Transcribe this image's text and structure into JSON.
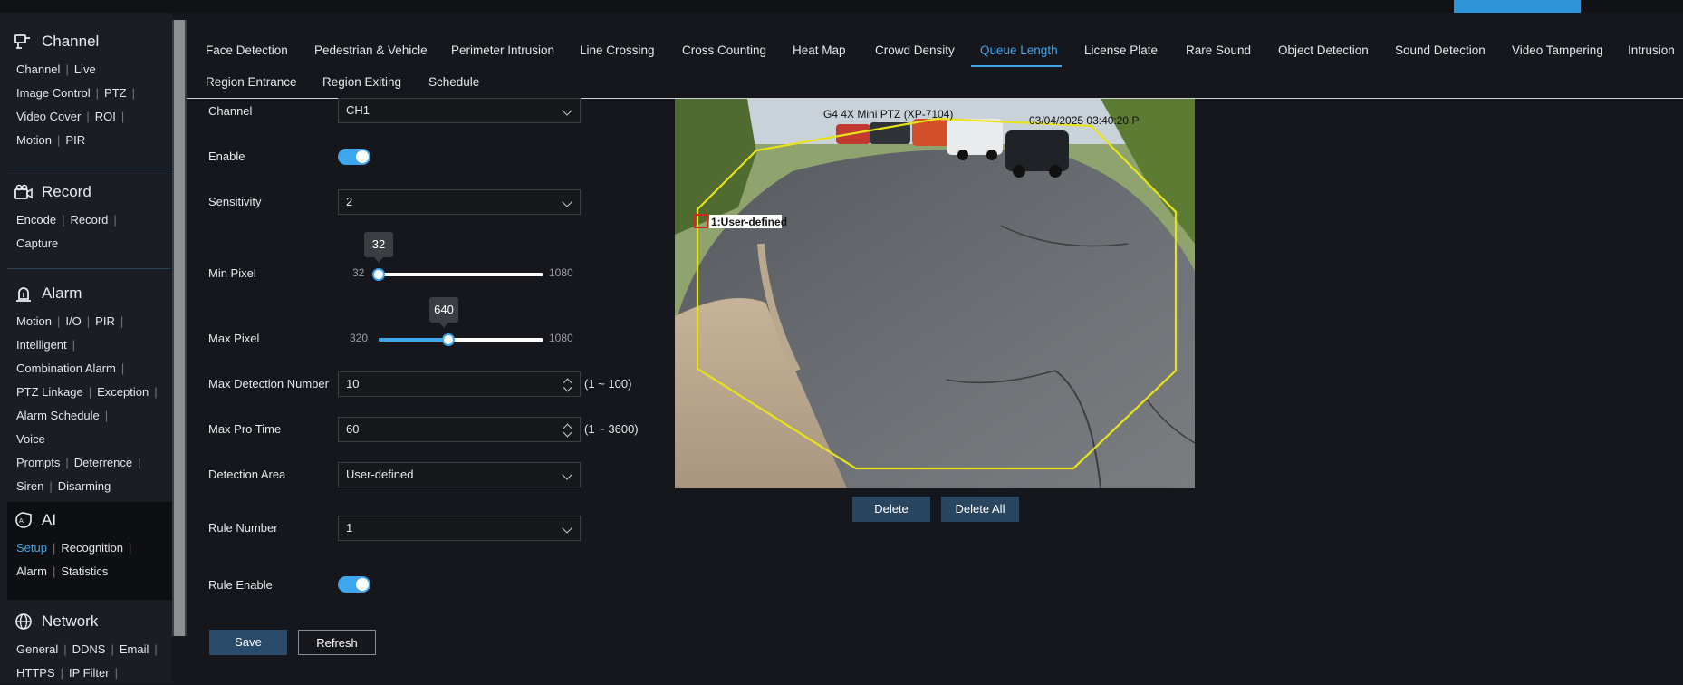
{
  "sidebar": {
    "channel": {
      "title": "Channel",
      "links": [
        "Channel",
        "Live",
        "Image Control",
        "PTZ",
        "Video Cover",
        "ROI",
        "Motion",
        "PIR"
      ]
    },
    "record": {
      "title": "Record",
      "links": [
        "Encode",
        "Record",
        "Capture"
      ]
    },
    "alarm": {
      "title": "Alarm",
      "links": [
        "Motion",
        "I/O",
        "PIR",
        "Intelligent",
        "Combination Alarm",
        "PTZ Linkage",
        "Exception",
        "Alarm Schedule",
        "Voice Prompts",
        "Deterrence",
        "Siren",
        "Disarming"
      ]
    },
    "ai": {
      "title": "AI",
      "links": [
        "Setup",
        "Recognition",
        "Alarm",
        "Statistics"
      ]
    },
    "network": {
      "title": "Network",
      "links": [
        "General",
        "DDNS",
        "Email",
        "HTTPS",
        "IP Filter"
      ]
    }
  },
  "tabs": [
    "Face Detection",
    "Pedestrian & Vehicle",
    "Perimeter Intrusion",
    "Line Crossing",
    "Cross Counting",
    "Heat Map",
    "Crowd Density",
    "Queue Length",
    "License Plate",
    "Rare Sound",
    "Object Detection",
    "Sound Detection",
    "Video Tampering",
    "Intrusion",
    "Region Entrance",
    "Region Exiting",
    "Schedule"
  ],
  "active_tab": "Queue Length",
  "form": {
    "channel_label": "Channel",
    "channel_value": "CH1",
    "enable_label": "Enable",
    "enable_on": true,
    "sensitivity_label": "Sensitivity",
    "sensitivity_value": "2",
    "min_pixel_label": "Min Pixel",
    "min_pixel_value": "32",
    "min_pixel_min": "32",
    "min_pixel_max": "1080",
    "max_pixel_label": "Max Pixel",
    "max_pixel_value": "640",
    "max_pixel_min": "320",
    "max_pixel_max": "1080",
    "max_detection_label": "Max Detection Number",
    "max_detection_value": "10",
    "max_detection_range": "(1 ~ 100)",
    "max_pro_time_label": "Max Pro Time",
    "max_pro_time_value": "60",
    "max_pro_time_range": "(1 ~ 3600)",
    "detection_area_label": "Detection Area",
    "detection_area_value": "User-defined",
    "rule_number_label": "Rule Number",
    "rule_number_value": "1",
    "rule_enable_label": "Rule Enable",
    "rule_enable_on": true
  },
  "buttons": {
    "save": "Save",
    "refresh": "Refresh",
    "delete": "Delete",
    "delete_all": "Delete All"
  },
  "preview": {
    "camera_name": "G4 4X Mini PTZ (XP-7104)",
    "timestamp": "03/04/2025 03:40:20 P",
    "region_label": "1:User-defined"
  },
  "colors": {
    "accent": "#3ea6ec",
    "region": "#e8e21a"
  }
}
